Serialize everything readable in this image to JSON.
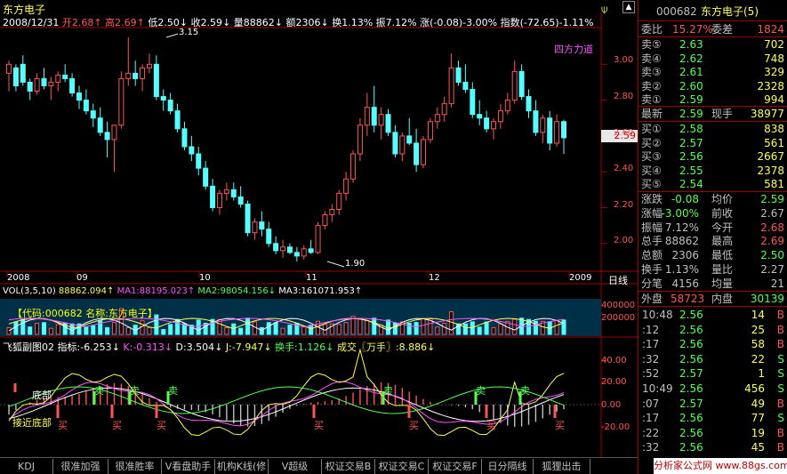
{
  "window": {
    "title": "东方电子"
  },
  "header": {
    "date": "2008/12/31",
    "open_label": "开",
    "open": "2.68",
    "high_label": "高",
    "high": "2.69",
    "low_label": "低",
    "low": "2.50",
    "close_label": "收",
    "close": "2.59",
    "vol_label": "量",
    "vol": "88862",
    "amt_label": "额",
    "amt": "2306",
    "turn_label": "换",
    "turn": "1.13%",
    "amp_label": "振",
    "amp": "7.12%",
    "chg_label": "涨",
    "chg": "(-0.08)-3.00%",
    "idx_label": "指数",
    "idx": "(-72.65)-1.11%"
  },
  "price_chart": {
    "indicator_label": "四方力道",
    "high_mark": "3.15",
    "low_mark": "1.90",
    "current_price": "2.59",
    "y_ticks": [
      "3.00",
      "2.80",
      "2.60",
      "2.40",
      "2.20",
      "2.00"
    ],
    "x_labels": [
      "2008",
      "09",
      "10",
      "11",
      "12",
      "2009"
    ],
    "period_label": "日线"
  },
  "vol_panel": {
    "title": "VOL(3,5,10)",
    "v1": "88862.094",
    "ma1": "MA1:88195.023",
    "ma2": "MA2:98054.156",
    "ma3": "MA3:161071.953",
    "info": "【代码:000682  名称:东方电子】",
    "y_ticks": [
      "400000",
      "200000"
    ]
  },
  "ind_panel": {
    "name": "飞狐副图02",
    "prefix": "指标:",
    "zb": "-6.253",
    "k": "K:-0.313",
    "d": "D:3.504",
    "j": "J:-7.947",
    "turnover": "换手:1.126",
    "deal": "成交〖万手〗:8.886",
    "y_ticks": [
      "40.00",
      "20.00",
      "0.00",
      "-20.00"
    ],
    "labels": {
      "bottom": "底部",
      "sell": "卖",
      "buy": "买",
      "near_bottom": "接近底部"
    }
  },
  "right_panel": {
    "code": "000682",
    "name": "东方电子(5)",
    "ratio_label": "委比",
    "ratio": "15.27%",
    "diff_label": "委差",
    "diff": "1824",
    "asks": [
      {
        "label": "卖⑤",
        "price": "2.63",
        "vol": "702"
      },
      {
        "label": "卖④",
        "price": "2.62",
        "vol": "748"
      },
      {
        "label": "卖③",
        "price": "2.61",
        "vol": "329"
      },
      {
        "label": "卖②",
        "price": "2.60",
        "vol": "2328"
      },
      {
        "label": "卖①",
        "price": "2.59",
        "vol": "994"
      }
    ],
    "last_label": "最新",
    "last": "2.59",
    "now_label": "现手",
    "now": "38977",
    "bids": [
      {
        "label": "买①",
        "price": "2.58",
        "vol": "838"
      },
      {
        "label": "买②",
        "price": "2.57",
        "vol": "561"
      },
      {
        "label": "买③",
        "price": "2.56",
        "vol": "2667"
      },
      {
        "label": "买④",
        "price": "2.55",
        "vol": "2378"
      },
      {
        "label": "买⑤",
        "price": "2.54",
        "vol": "581"
      }
    ],
    "stats": [
      {
        "l1": "涨跌",
        "v1": "-0.08",
        "l2": "均价",
        "v2": "2.59"
      },
      {
        "l1": "涨幅",
        "v1": "-3.00%",
        "l2": "前收",
        "v2": "2.67"
      },
      {
        "l1": "振幅",
        "v1": "7.12%",
        "l2": "今开",
        "v2": "2.68"
      },
      {
        "l1": "总手",
        "v1": "88862",
        "l2": "最高",
        "v2": "2.69"
      },
      {
        "l1": "总额",
        "v1": "2306",
        "l2": "最低",
        "v2": "2.50"
      },
      {
        "l1": "换手",
        "v1": "1.13%",
        "l2": "量比",
        "v2": "2.27"
      },
      {
        "l1": "分笔",
        "v1": "4156",
        "l2": "均量",
        "v2": "21"
      }
    ],
    "outer_label": "外盘",
    "outer": "58723",
    "inner_label": "内盘",
    "inner": "30139",
    "ticks": [
      {
        "time": "10:48",
        "price": "2.56",
        "vol": "14",
        "dir": "B"
      },
      {
        "time": ":12",
        "price": "2.56",
        "vol": "25",
        "dir": "B"
      },
      {
        "time": ":17",
        "price": "2.56",
        "vol": "58",
        "dir": "B"
      },
      {
        "time": ":32",
        "price": "2.56",
        "vol": "22",
        "dir": "S"
      },
      {
        "time": ":52",
        "price": "2.57",
        "vol": "1",
        "dir": "S"
      },
      {
        "time": "10:49",
        "price": "2.56",
        "vol": "456",
        "dir": "S"
      },
      {
        "time": ":07",
        "price": "2.57",
        "vol": "49",
        "dir": "B"
      },
      {
        "time": ":17",
        "price": "2.56",
        "vol": "77",
        "dir": "S"
      },
      {
        "time": ":22",
        "price": "2.56",
        "vol": "19",
        "dir": "B"
      },
      {
        "time": ":32",
        "price": "2.56",
        "vol": "45",
        "dir": "B"
      }
    ]
  },
  "tabs": [
    "KDJ",
    "很准加强",
    "很准胜率",
    "V看盘助手",
    "机构K线(修",
    "V超级MACD",
    "权证交易B",
    "权证交易C",
    "权证交易F",
    "日分隔线",
    "狐狸出击"
  ],
  "watermark": "分析家公式网 www.88gs.com",
  "candles": [
    [
      2.95,
      3.02,
      2.85,
      3.0
    ],
    [
      2.98,
      3.0,
      2.85,
      2.88
    ],
    [
      3.0,
      3.05,
      2.88,
      2.9
    ],
    [
      2.9,
      2.92,
      2.8,
      2.85
    ],
    [
      2.85,
      2.95,
      2.83,
      2.92
    ],
    [
      2.92,
      2.98,
      2.86,
      2.88
    ],
    [
      2.88,
      2.93,
      2.8,
      2.9
    ],
    [
      2.9,
      2.96,
      2.85,
      2.94
    ],
    [
      2.94,
      3.0,
      2.9,
      2.92
    ],
    [
      2.92,
      2.95,
      2.82,
      2.84
    ],
    [
      2.84,
      2.88,
      2.75,
      2.8
    ],
    [
      2.8,
      2.86,
      2.72,
      2.74
    ],
    [
      2.74,
      2.78,
      2.65,
      2.7
    ],
    [
      2.7,
      2.76,
      2.6,
      2.62
    ],
    [
      2.62,
      2.68,
      2.48,
      2.58
    ],
    [
      2.58,
      2.63,
      2.4,
      2.66
    ],
    [
      2.66,
      2.96,
      2.64,
      2.92
    ],
    [
      2.92,
      3.15,
      2.88,
      2.95
    ],
    [
      2.95,
      3.02,
      2.88,
      2.92
    ],
    [
      2.92,
      3.0,
      2.85,
      2.98
    ],
    [
      2.98,
      3.06,
      2.95,
      3.0
    ],
    [
      3.0,
      3.05,
      2.8,
      2.82
    ],
    [
      2.82,
      2.86,
      2.74,
      2.8
    ],
    [
      2.8,
      2.84,
      2.72,
      2.74
    ],
    [
      2.74,
      2.78,
      2.62,
      2.64
    ],
    [
      2.64,
      2.68,
      2.52,
      2.54
    ],
    [
      2.54,
      2.6,
      2.46,
      2.5
    ],
    [
      2.5,
      2.54,
      2.38,
      2.42
    ],
    [
      2.42,
      2.46,
      2.3,
      2.32
    ],
    [
      2.32,
      2.36,
      2.18,
      2.2
    ],
    [
      2.2,
      2.3,
      2.16,
      2.28
    ],
    [
      2.28,
      2.34,
      2.24,
      2.3
    ],
    [
      2.3,
      2.34,
      2.24,
      2.26
    ],
    [
      2.26,
      2.32,
      2.2,
      2.22
    ],
    [
      2.22,
      2.24,
      2.04,
      2.06
    ],
    [
      2.06,
      2.14,
      2.02,
      2.12
    ],
    [
      2.12,
      2.18,
      2.04,
      2.08
    ],
    [
      2.08,
      2.12,
      1.98,
      2.0
    ],
    [
      2.0,
      2.04,
      1.94,
      1.96
    ],
    [
      1.96,
      2.02,
      1.92,
      1.98
    ],
    [
      1.98,
      2.0,
      1.94,
      1.95
    ],
    [
      1.95,
      1.98,
      1.9,
      1.93
    ],
    [
      1.93,
      1.99,
      1.91,
      1.97
    ],
    [
      1.97,
      2.02,
      1.94,
      1.95
    ],
    [
      1.95,
      2.12,
      1.94,
      2.1
    ],
    [
      2.1,
      2.18,
      2.08,
      2.16
    ],
    [
      2.16,
      2.22,
      2.12,
      2.19
    ],
    [
      2.19,
      2.3,
      2.16,
      2.28
    ],
    [
      2.28,
      2.4,
      2.24,
      2.36
    ],
    [
      2.36,
      2.52,
      2.34,
      2.5
    ],
    [
      2.5,
      2.7,
      2.46,
      2.66
    ],
    [
      2.66,
      2.84,
      2.6,
      2.76
    ],
    [
      2.76,
      2.88,
      2.62,
      2.66
    ],
    [
      2.66,
      2.76,
      2.58,
      2.72
    ],
    [
      2.72,
      2.75,
      2.6,
      2.62
    ],
    [
      2.62,
      2.66,
      2.48,
      2.5
    ],
    [
      2.5,
      2.62,
      2.46,
      2.6
    ],
    [
      2.6,
      2.7,
      2.55,
      2.56
    ],
    [
      2.56,
      2.64,
      2.4,
      2.44
    ],
    [
      2.44,
      2.6,
      2.42,
      2.58
    ],
    [
      2.58,
      2.7,
      2.56,
      2.68
    ],
    [
      2.68,
      2.76,
      2.64,
      2.72
    ],
    [
      2.72,
      2.82,
      2.68,
      2.78
    ],
    [
      2.78,
      3.06,
      2.76,
      2.98
    ],
    [
      2.98,
      3.02,
      2.88,
      2.9
    ],
    [
      2.9,
      3.0,
      2.84,
      2.86
    ],
    [
      2.86,
      2.9,
      2.7,
      2.72
    ],
    [
      2.72,
      2.8,
      2.66,
      2.7
    ],
    [
      2.7,
      2.74,
      2.62,
      2.64
    ],
    [
      2.64,
      2.7,
      2.58,
      2.68
    ],
    [
      2.68,
      2.78,
      2.64,
      2.74
    ],
    [
      2.74,
      2.84,
      2.72,
      2.8
    ],
    [
      2.8,
      3.02,
      2.78,
      2.96
    ],
    [
      2.96,
      3.0,
      2.8,
      2.82
    ],
    [
      2.82,
      2.86,
      2.7,
      2.74
    ],
    [
      2.74,
      2.8,
      2.6,
      2.62
    ],
    [
      2.62,
      2.72,
      2.56,
      2.7
    ],
    [
      2.7,
      2.74,
      2.52,
      2.56
    ],
    [
      2.56,
      2.72,
      2.54,
      2.68
    ],
    [
      2.68,
      2.69,
      2.5,
      2.59
    ]
  ]
}
